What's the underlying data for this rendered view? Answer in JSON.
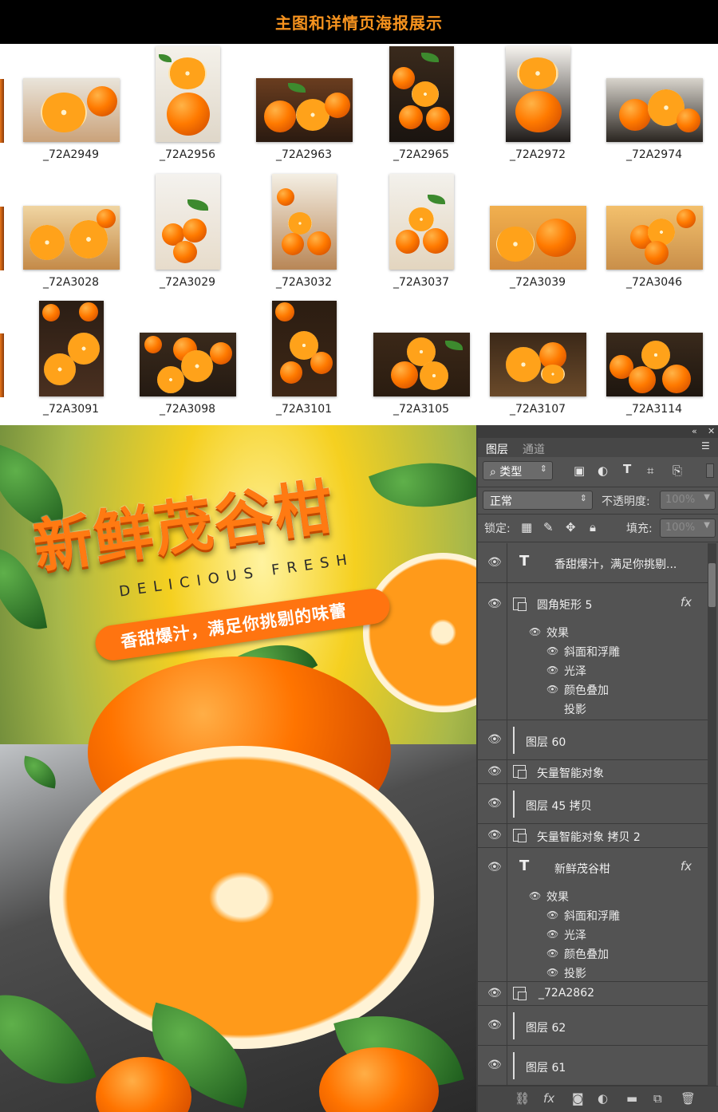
{
  "header": {
    "title": "主图和详情页海报展示"
  },
  "thumbnails": [
    {
      "name": "_72A2949"
    },
    {
      "name": "_72A2956"
    },
    {
      "name": "_72A2963"
    },
    {
      "name": "_72A2965"
    },
    {
      "name": "_72A2972"
    },
    {
      "name": "_72A2974"
    },
    {
      "name": "_72A3028"
    },
    {
      "name": "_72A3029"
    },
    {
      "name": "_72A3032"
    },
    {
      "name": "_72A3037"
    },
    {
      "name": "_72A3039"
    },
    {
      "name": "_72A3046"
    },
    {
      "name": "_72A3091"
    },
    {
      "name": "_72A3098"
    },
    {
      "name": "_72A3101"
    },
    {
      "name": "_72A3105"
    },
    {
      "name": "_72A3107"
    },
    {
      "name": "_72A3114"
    }
  ],
  "poster": {
    "title": "新鲜茂谷柑",
    "subtitle_en": "DELICIOUS FRESH",
    "tagline": "香甜爆汁，满足你挑剔的味蕾"
  },
  "panel": {
    "collapse_icon": "«",
    "close_icon": "✕",
    "tabs": [
      "图层",
      "通道"
    ],
    "filter": {
      "label": "类型"
    },
    "blend_mode": "正常",
    "opacity": {
      "label": "不透明度:",
      "value": "100%"
    },
    "lock_label": "锁定:",
    "fill": {
      "label": "填充:",
      "value": "100%"
    },
    "layers": [
      {
        "type": "text",
        "name": "香甜爆汁，满足你挑剔...",
        "fx": ""
      },
      {
        "type": "shape",
        "name": "圆角矩形 5",
        "fx": "fx",
        "effects_label": "效果",
        "effects": [
          "斜面和浮雕",
          "光泽",
          "颜色叠加",
          "投影"
        ]
      },
      {
        "type": "pixel",
        "name": "图层 60",
        "fx": ""
      },
      {
        "type": "smart",
        "name": "矢量智能对象",
        "fx": ""
      },
      {
        "type": "pixel",
        "name": "图层 45 拷贝",
        "fx": ""
      },
      {
        "type": "smart",
        "name": "矢量智能对象 拷贝 2",
        "fx": ""
      },
      {
        "type": "text",
        "name": "新鲜茂谷柑",
        "fx": "fx",
        "effects_label": "效果",
        "effects": [
          "斜面和浮雕",
          "光泽",
          "颜色叠加",
          "投影"
        ]
      },
      {
        "type": "smart",
        "name": "_72A2862",
        "fx": ""
      },
      {
        "type": "pixel",
        "name": "图层 62",
        "fx": ""
      },
      {
        "type": "pixel",
        "name": "图层 61",
        "fx": ""
      }
    ],
    "bottom_icons": [
      "link-icon",
      "fx-icon",
      "mask-icon",
      "adjustment-icon",
      "folder-icon",
      "new-layer-icon",
      "trash-icon"
    ]
  },
  "colors": {
    "accent": "#f7931e",
    "panel_bg": "#535353",
    "orange": "#ff7a12"
  }
}
